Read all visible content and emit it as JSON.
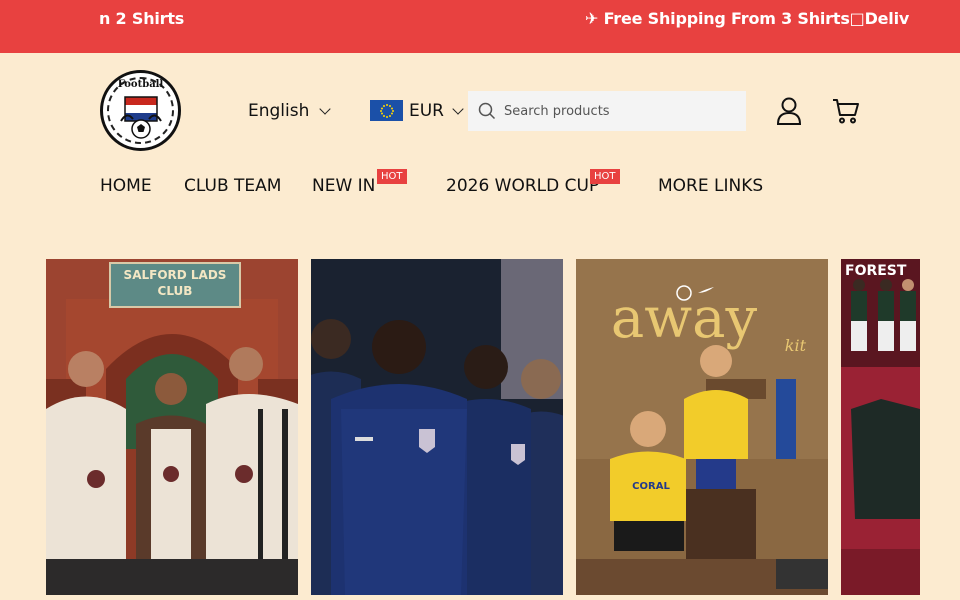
{
  "announcement": {
    "message_left": "n 2 Shirts",
    "message_right": "✈ Free Shipping From 3 Shirts□Deliv"
  },
  "header": {
    "logo_text": "Football",
    "language": "English",
    "currency": "EUR",
    "search_placeholder": "Search products"
  },
  "nav": {
    "items": [
      {
        "label": "HOME"
      },
      {
        "label": "CLUB TEAM"
      },
      {
        "label": "NEW IN",
        "badge": "HOT"
      },
      {
        "label": "2026 WORLD CUP",
        "badge": "HOT"
      },
      {
        "label": "MORE LINKS"
      }
    ]
  },
  "banners": {
    "card1_sign": "SALFORD LADS",
    "card1_sign2": "CLUB",
    "card3_title": "away",
    "card3_sub": "kit",
    "card3_sponsor": "CORAL",
    "card4_title": "FOREST"
  },
  "colors": {
    "announcement_bg": "#e84140",
    "page_bg": "#fcebd0",
    "hot_badge": "#e84140"
  }
}
